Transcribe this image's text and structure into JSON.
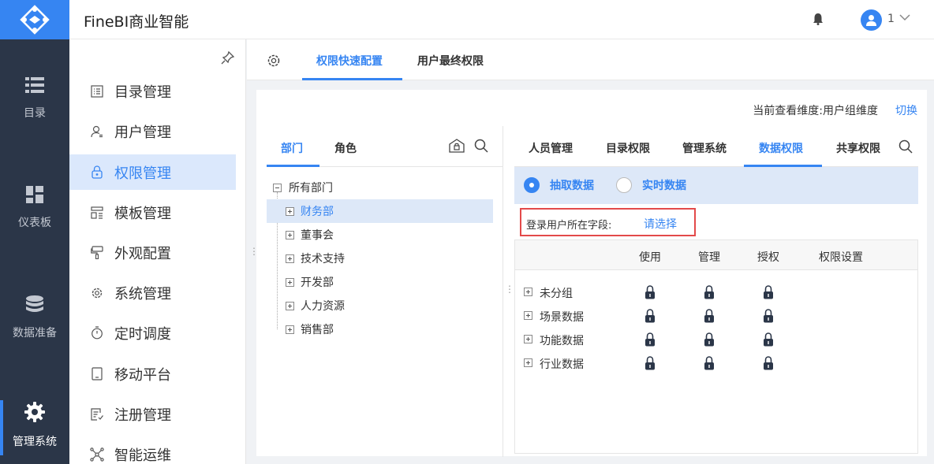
{
  "header": {
    "title": "FineBI商业智能",
    "user": "1"
  },
  "rail": {
    "items": [
      {
        "label": "目录",
        "icon": "list-icon"
      },
      {
        "label": "仪表板",
        "icon": "dashboard-icon"
      },
      {
        "label": "数据准备",
        "icon": "database-icon"
      },
      {
        "label": "管理系统",
        "icon": "gear-icon",
        "active": true
      }
    ]
  },
  "menu": {
    "items": [
      {
        "label": "目录管理",
        "icon": "catalog-icon"
      },
      {
        "label": "用户管理",
        "icon": "user-icon"
      },
      {
        "label": "权限管理",
        "icon": "lock-icon",
        "active": true
      },
      {
        "label": "模板管理",
        "icon": "template-icon"
      },
      {
        "label": "外观配置",
        "icon": "brush-icon"
      },
      {
        "label": "系统管理",
        "icon": "gear-icon"
      },
      {
        "label": "定时调度",
        "icon": "timer-icon"
      },
      {
        "label": "移动平台",
        "icon": "mobile-icon"
      },
      {
        "label": "注册管理",
        "icon": "register-icon"
      },
      {
        "label": "智能运维",
        "icon": "network-icon"
      }
    ]
  },
  "tabs": {
    "items": [
      "权限快速配置",
      "用户最终权限"
    ],
    "active": 0
  },
  "content": {
    "dimension_text": "当前查看维度:用户组维度",
    "switch_label": "切换",
    "left": {
      "tabs": [
        "部门",
        "角色"
      ],
      "tree": {
        "root": "所有部门",
        "children": [
          "财务部",
          "董事会",
          "技术支持",
          "开发部",
          "人力资源",
          "销售部"
        ],
        "selected": "财务部"
      }
    },
    "right": {
      "tabs": [
        "人员管理",
        "目录权限",
        "管理系统",
        "数据权限",
        "共享权限"
      ],
      "active_tab": "数据权限",
      "radios": [
        {
          "label": "抽取数据",
          "checked": true
        },
        {
          "label": "实时数据",
          "checked": false
        }
      ],
      "field_label": "登录用户所在字段:",
      "field_select": "请选择",
      "table": {
        "headers": [
          "使用",
          "管理",
          "授权",
          "权限设置"
        ],
        "rows": [
          "未分组",
          "场景数据",
          "功能数据",
          "行业数据"
        ]
      }
    }
  },
  "colors": {
    "accent": "#3685f2",
    "rail": "#2b3648",
    "highlight": "#e34a4a"
  }
}
